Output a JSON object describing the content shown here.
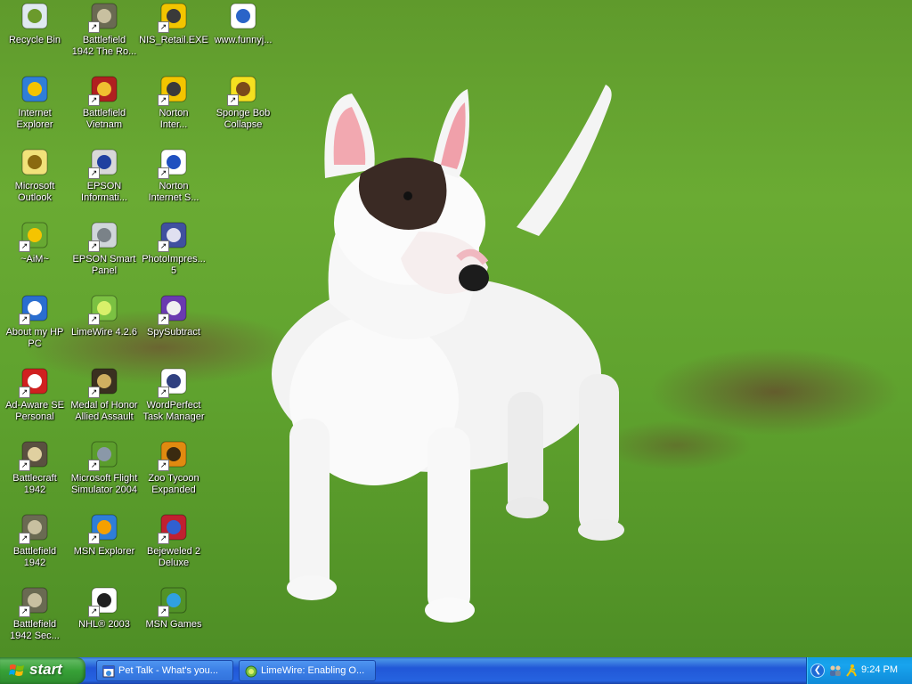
{
  "desktop_icons": [
    {
      "label": "Recycle Bin",
      "icon": "recycle-bin-icon",
      "shortcut": false
    },
    {
      "label": "Battlefield\n1942 The Ro...",
      "icon": "battlefield-icon",
      "shortcut": true
    },
    {
      "label": "NIS_Retail.EXE",
      "icon": "norton-globe-icon",
      "shortcut": true
    },
    {
      "label": "www.funnyj...",
      "icon": "media-file-icon",
      "shortcut": false
    },
    {
      "label": "Internet\nExplorer",
      "icon": "internet-explorer-icon",
      "shortcut": false
    },
    {
      "label": "Battlefield\nVietnam",
      "icon": "battlefield-vietnam-icon",
      "shortcut": true
    },
    {
      "label": "Norton\nInter...",
      "icon": "norton-globe-icon",
      "shortcut": true
    },
    {
      "label": "Sponge Bob\nCollapse",
      "icon": "spongebob-icon",
      "shortcut": true
    },
    {
      "label": "Microsoft\nOutlook",
      "icon": "outlook-icon",
      "shortcut": false
    },
    {
      "label": "EPSON\nInformati...",
      "icon": "epson-info-icon",
      "shortcut": true
    },
    {
      "label": "Norton\nInternet S...",
      "icon": "window-icon",
      "shortcut": true
    },
    {
      "label": "~AiM~",
      "icon": "aim-running-man-icon",
      "shortcut": true
    },
    {
      "label": "EPSON Smart\nPanel",
      "icon": "scanner-icon",
      "shortcut": true
    },
    {
      "label": "PhotoImpres...\n5",
      "icon": "photoimpression-icon",
      "shortcut": true
    },
    {
      "label": "About my HP\nPC",
      "icon": "hp-info-icon",
      "shortcut": true
    },
    {
      "label": "LimeWire 4.2.6",
      "icon": "limewire-icon",
      "shortcut": true
    },
    {
      "label": "SpySubtract",
      "icon": "spysubtract-icon",
      "shortcut": true
    },
    {
      "label": "Ad-Aware SE\nPersonal",
      "icon": "adaware-icon",
      "shortcut": true
    },
    {
      "label": "Medal of Honor\nAllied Assault",
      "icon": "medal-of-honor-icon",
      "shortcut": true
    },
    {
      "label": "WordPerfect\nTask Manager",
      "icon": "wordperfect-icon",
      "shortcut": true
    },
    {
      "label": "Battlecraft\n1942",
      "icon": "battlecraft-icon",
      "shortcut": true
    },
    {
      "label": "Microsoft Flight\nSimulator 2004",
      "icon": "airplane-icon",
      "shortcut": true
    },
    {
      "label": "Zoo Tycoon\nExpanded",
      "icon": "zoo-tycoon-icon",
      "shortcut": true
    },
    {
      "label": "Battlefield\n1942",
      "icon": "battlefield-icon",
      "shortcut": true
    },
    {
      "label": "MSN Explorer",
      "icon": "msn-butterfly-icon",
      "shortcut": true
    },
    {
      "label": "Bejeweled 2\nDeluxe",
      "icon": "bejeweled-icon",
      "shortcut": true
    },
    {
      "label": "Battlefield\n1942 Sec...",
      "icon": "battlefield-icon",
      "shortcut": true
    },
    {
      "label": "NHL® 2003",
      "icon": "nhl-icon",
      "shortcut": true
    },
    {
      "label": "MSN Games",
      "icon": "msn-games-icon",
      "shortcut": true
    }
  ],
  "taskbar": {
    "start_label": "start",
    "tasks": [
      {
        "label": "Pet Talk - What's you...",
        "icon": "browser-window-icon"
      },
      {
        "label": "LimeWire: Enabling O...",
        "icon": "limewire-icon"
      }
    ],
    "tray": {
      "clock": "9:24 PM",
      "icons": [
        "show-hidden-icons-chevron-icon",
        "network-users-icon",
        "aim-running-man-icon"
      ]
    }
  },
  "colors": {
    "taskbar_blue": "#2157d7",
    "start_green": "#37a137",
    "tray_blue": "#139de6",
    "grass_green": "#6aab33"
  }
}
